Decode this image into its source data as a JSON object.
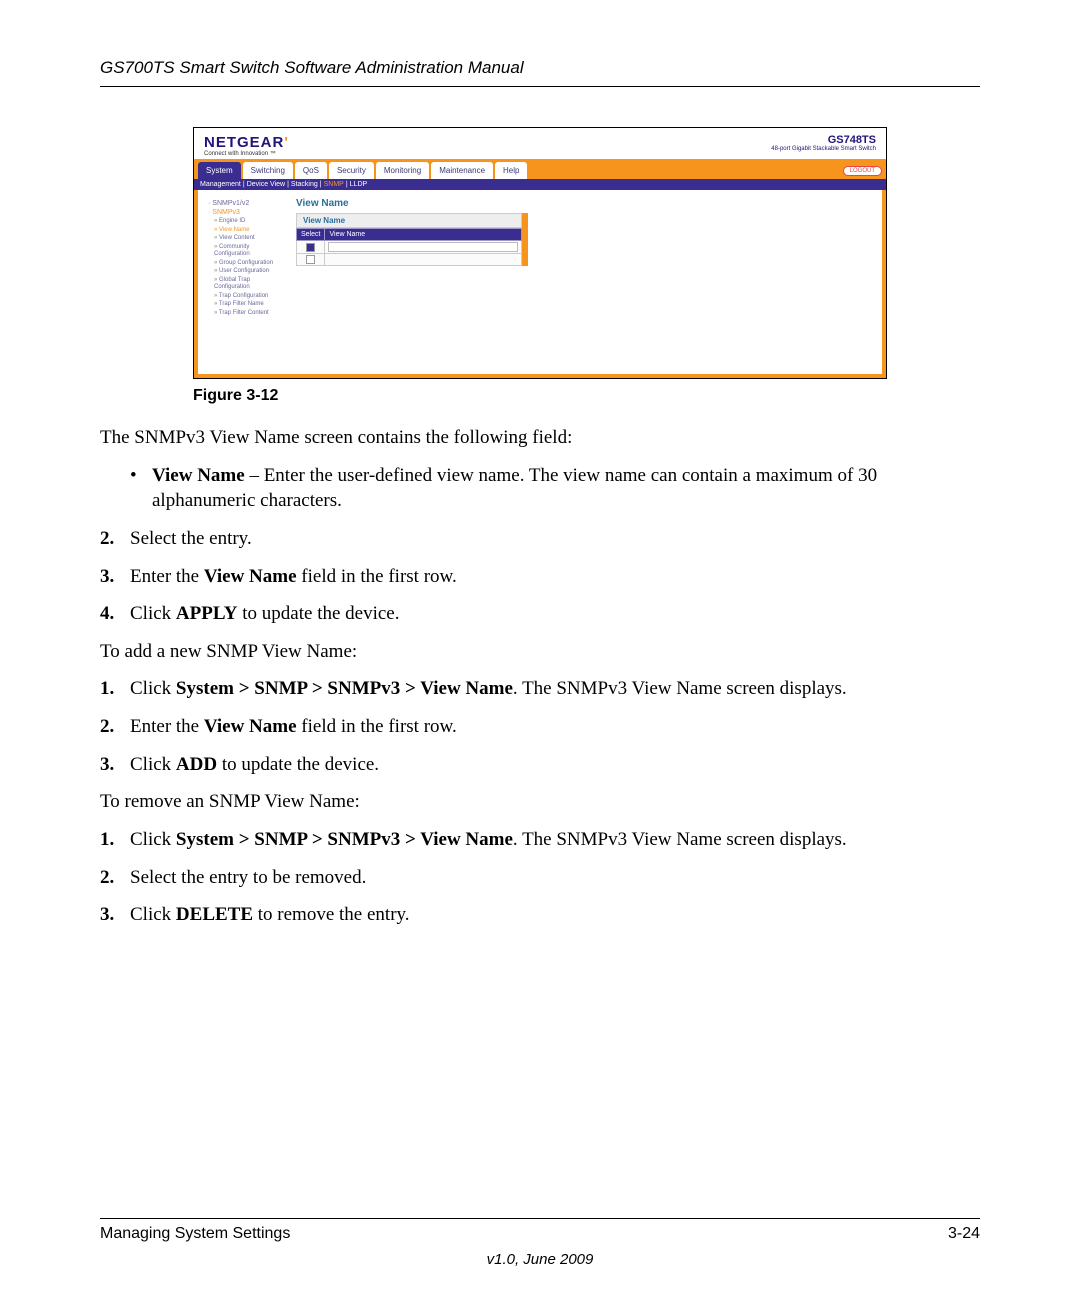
{
  "header": {
    "title": "GS700TS Smart Switch Software Administration Manual"
  },
  "figure": {
    "label": "Figure 3-12"
  },
  "screenshot": {
    "brand": "NETGEAR",
    "tagline": "Connect with Innovation ™",
    "model": "GS748TS",
    "model_desc": "48-port Gigabit Stackable Smart Switch",
    "tabs": [
      "System",
      "Switching",
      "QoS",
      "Security",
      "Monitoring",
      "Maintenance",
      "Help"
    ],
    "active_tab": "System",
    "logout": "LOGOUT",
    "subnav": [
      "Management",
      "Device View",
      "Stacking",
      "SNMP",
      "LLDP"
    ],
    "active_subnav": "SNMP",
    "side": {
      "cat1": "SNMPv1/v2",
      "cat2": "SNMPv3",
      "items": [
        "Engine ID",
        "View Name",
        "View Content",
        "Community Configuration",
        "Group Configuration",
        "User Configuration",
        "Global Trap Configuration",
        "Trap Configuration",
        "Trap Filter Name",
        "Trap Filter Content"
      ],
      "active_item": "View Name"
    },
    "main": {
      "title": "View Name",
      "panel_header": "View Name",
      "col_select": "Select",
      "col_viewname": "View Name"
    }
  },
  "text": {
    "intro": "The SNMPv3 View Name screen contains the following field:",
    "bullet_label": "View Name",
    "bullet_rest": " – Enter the user-defined view name. The view name can contain a maximum of 30 alphanumeric characters.",
    "s2_num": "2.",
    "s2": "Select the entry.",
    "s3_num": "3.",
    "s3a": "Enter the ",
    "s3b": "View Name",
    "s3c": " field in the first row.",
    "s4_num": "4.",
    "s4a": "Click ",
    "s4b": "APPLY",
    "s4c": " to update the device.",
    "addhdr": "To add a new SNMP View Name:",
    "a1_num": "1.",
    "a1a": "Click ",
    "a1b": "System > SNMP > SNMPv3 > View Name",
    "a1c": ". The SNMPv3 View Name screen displays.",
    "a2_num": "2.",
    "a2a": "Enter the ",
    "a2b": "View Name",
    "a2c": " field in the first row.",
    "a3_num": "3.",
    "a3a": "Click ",
    "a3b": "ADD",
    "a3c": " to update the device.",
    "remhdr": "To remove an SNMP View Name:",
    "r1_num": "1.",
    "r1a": "Click ",
    "r1b": "System > SNMP > SNMPv3 > View Name",
    "r1c": ". The SNMPv3 View Name screen displays.",
    "r2_num": "2.",
    "r2": "Select the entry to be removed.",
    "r3_num": "3.",
    "r3a": "Click ",
    "r3b": "DELETE",
    "r3c": " to remove the entry."
  },
  "footer": {
    "left": "Managing System Settings",
    "right": "3-24",
    "version": "v1.0, June 2009"
  }
}
